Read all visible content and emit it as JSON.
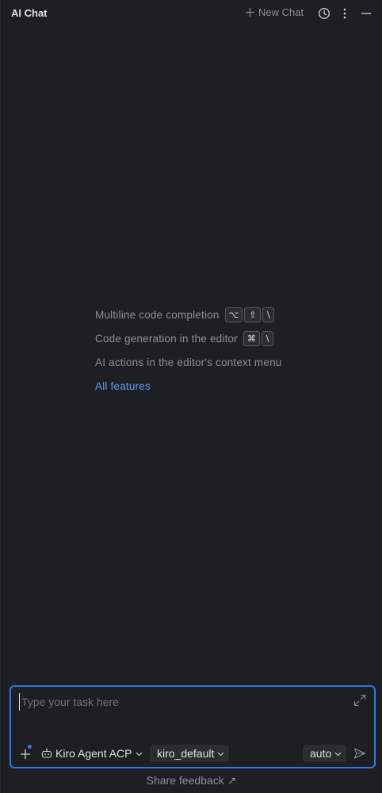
{
  "header": {
    "title": "AI Chat",
    "new_chat_label": "New Chat",
    "history_icon": "history-icon",
    "more_icon": "more-vertical-icon",
    "minimize_icon": "minimize-icon"
  },
  "empty_state": {
    "hints": [
      {
        "label": "Multiline code completion",
        "keys": [
          "⌥",
          "⇧",
          "\\"
        ]
      },
      {
        "label": "Code generation in the editor",
        "keys": [
          "⌘",
          "\\"
        ]
      },
      {
        "label": "AI actions in the editor's context menu",
        "keys": []
      }
    ],
    "all_features_link": "All features"
  },
  "input": {
    "placeholder": "Type your task here",
    "value": "",
    "agent_selector": "Kiro Agent ACP",
    "profile_selector": "kiro_default",
    "mode_selector": "auto"
  },
  "footer": {
    "share_feedback": "Share feedback ↗"
  },
  "colors": {
    "background": "#1e1f22",
    "accent": "#3574f0",
    "link": "#5d9cf2",
    "muted_text": "#8c8f96"
  }
}
